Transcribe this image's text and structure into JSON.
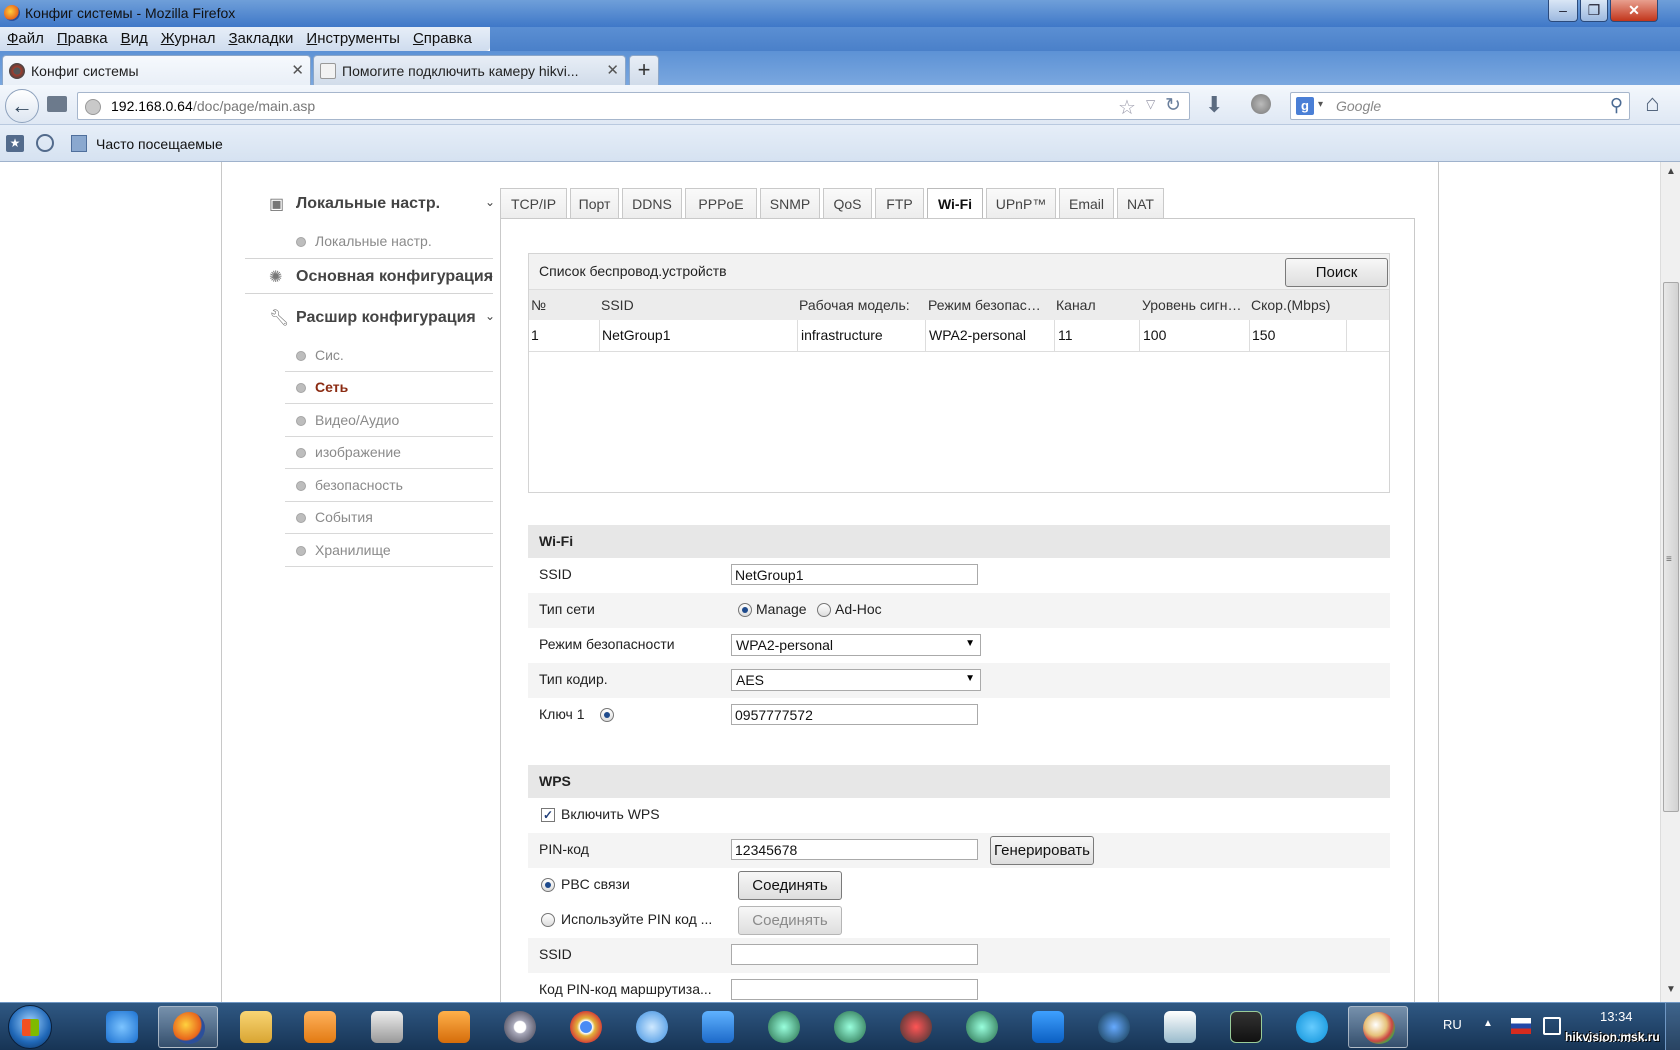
{
  "window": {
    "title": "Конфиг системы - Mozilla Firefox",
    "min_label": "–",
    "max_label": "❐",
    "close_label": "✕"
  },
  "menu": [
    "Файл",
    "Правка",
    "Вид",
    "Журнал",
    "Закладки",
    "Инструменты",
    "Справка"
  ],
  "tabs": [
    {
      "label": "Конфиг системы",
      "close": "✕",
      "active": true
    },
    {
      "label": "Помогите подключить камеру hikvi...",
      "close": "✕",
      "active": false
    }
  ],
  "newtab_label": "+",
  "nav": {
    "back": "←",
    "url_host": "192.168.0.64",
    "url_path": "/doc/page/main.asp",
    "star": "☆",
    "dropdown": "▽",
    "reload": "↻",
    "download": "⬇",
    "search_engine": "g",
    "search_engine_drop": "▾",
    "search_placeholder": "Google",
    "search_glyph": "⚲",
    "home": "⌂"
  },
  "bookmarks": {
    "label": "Часто посещаемые"
  },
  "sidebar": {
    "groups": [
      {
        "title": "Локальные настр.",
        "icon": "monitor-icon",
        "chev": "⌄"
      },
      {
        "title": "Основная конфигурация",
        "icon": "gear-icon",
        "chev": "⌄"
      },
      {
        "title": "Расшир конфигурация",
        "icon": "wrench-icon",
        "chev": "⌄"
      }
    ],
    "local_items": [
      "Локальные настр."
    ],
    "adv_items": [
      "Сис.",
      "Сеть",
      "Видео/Аудио",
      "изображение",
      "безопасность",
      "События",
      "Хранилище"
    ],
    "active_item": "Сеть"
  },
  "config_tabs": [
    "TCP/IP",
    "Порт",
    "DDNS",
    "PPPoE",
    "SNMP",
    "QoS",
    "FTP",
    "Wi-Fi",
    "UPnP™",
    "Email",
    "NAT"
  ],
  "active_tab": "Wi-Fi",
  "device_list": {
    "title": "Список беспровод.устройств",
    "search_button": "Поиск",
    "columns": [
      "№",
      "SSID",
      "Рабочая модель:",
      "Режим безопас…",
      "Канал",
      "Уровень сигн…",
      "Скор.(Mbps)"
    ],
    "rows": [
      [
        "1",
        "NetGroup1",
        "infrastructure",
        "WPA2-personal",
        "11",
        "100",
        "150"
      ]
    ]
  },
  "wifi": {
    "header": "Wi-Fi",
    "ssid_label": "SSID",
    "ssid_value": "NetGroup1",
    "net_type_label": "Тип сети",
    "net_type_options": [
      "Manage",
      "Ad-Hoc"
    ],
    "net_type_selected": "Manage",
    "security_label": "Режим безопасности",
    "security_value": "WPA2-personal",
    "encryption_label": "Тип кодир.",
    "encryption_value": "AES",
    "key_label": "Ключ 1",
    "key_value": "0957777572"
  },
  "wps": {
    "header": "WPS",
    "enable_label": "Включить WPS",
    "enabled": true,
    "pin_label": "PIN-код",
    "pin_value": "12345678",
    "generate_button": "Генерировать",
    "pbc_label": "PBC связи",
    "connect_button": "Соединять",
    "use_pin_label": "Используйте PIN код ...",
    "connect_button_2": "Соединять",
    "ssid_label": "SSID",
    "ssid_value": "",
    "router_pin_label": "Код PIN-код маршрутиза...",
    "router_pin_value": ""
  },
  "scrollbar": {
    "up": "▲",
    "grip": "≡",
    "down": "▼"
  },
  "taskbar": {
    "apps": [
      "ie-icon",
      "firefox-icon",
      "explorer-icon",
      "media-player-icon",
      "media-classic-icon",
      "winamp-icon",
      "webcam-icon",
      "chrome-icon",
      "skype-qip-icon",
      "download-icon",
      "trainer-icon",
      "trainer-icon-2",
      "security-icon",
      "trainer-icon-3",
      "teamviewer-icon",
      "shield-icon",
      "window-icon",
      "monitor-icon",
      "skype-icon",
      "paint-icon"
    ],
    "lang": "RU",
    "tray_up": "▲",
    "time": "13:34",
    "date": "17.01.2014"
  },
  "watermark": "hikvision.msk.ru"
}
